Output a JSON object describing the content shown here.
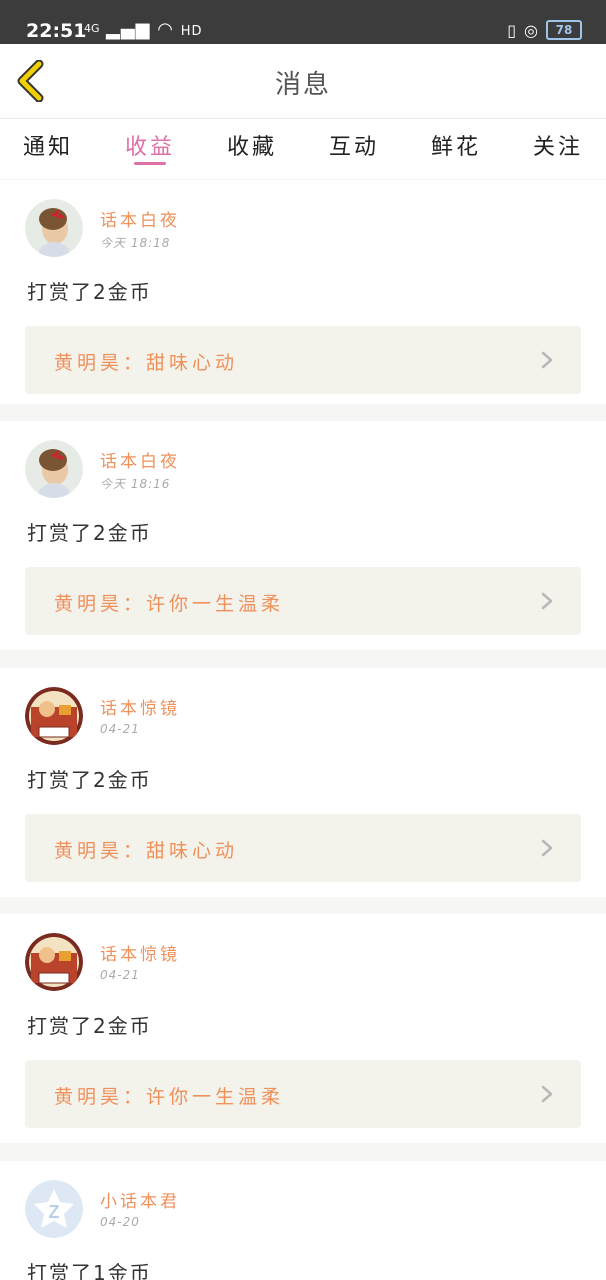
{
  "status_bar": {
    "time": "22:51",
    "signal_text": "4G",
    "network_text": "HD",
    "battery": "78"
  },
  "header": {
    "title": "消息",
    "back_icon": "chevron-left-icon",
    "accent_color": "#e8b400"
  },
  "tabs": [
    {
      "label": "通知"
    },
    {
      "label": "收益",
      "active": true
    },
    {
      "label": "收藏"
    },
    {
      "label": "互动"
    },
    {
      "label": "鲜花"
    },
    {
      "label": "关注"
    }
  ],
  "messages": [
    {
      "user": "话本白夜",
      "time": "今天 18:18",
      "action": "打赏了2金币",
      "ref": "黄明昊：甜味心动"
    },
    {
      "user": "话本白夜",
      "time": "今天 18:16",
      "action": "打赏了2金币",
      "ref": "黄明昊：许你一生温柔"
    },
    {
      "user": "话本惊镜",
      "time": "04-21",
      "action": "打赏了2金币",
      "ref": "黄明昊：甜味心动"
    },
    {
      "user": "话本惊镜",
      "time": "04-21",
      "action": "打赏了2金币",
      "ref": "黄明昊：许你一生温柔"
    },
    {
      "user": "小话本君",
      "time": "04-20",
      "action": "打赏了1金币",
      "ref": ""
    }
  ],
  "colors": {
    "tab_active": "#e070a8",
    "name": "#f0905a",
    "ref_bg": "#f3f3ec"
  }
}
